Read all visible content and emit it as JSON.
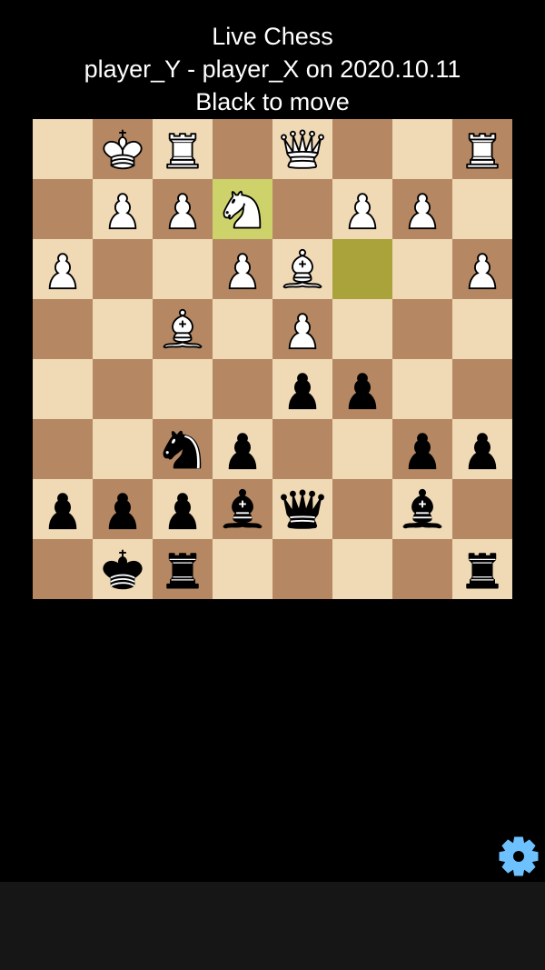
{
  "header": {
    "title": "Live Chess",
    "game": "player_Y - player_X on 2020.10.11",
    "status": "Black to move"
  },
  "board": {
    "orientation": "black",
    "colors": {
      "light": "#F0D9B5",
      "dark": "#B58863",
      "last_move_to": "#CDD26A",
      "last_move_from": "#AAA23A"
    },
    "last_move": {
      "to": [
        1,
        3
      ],
      "from": [
        2,
        5
      ]
    },
    "rows": [
      [
        "",
        "K",
        "R",
        "",
        "Q",
        "",
        "",
        "R"
      ],
      [
        "",
        "P",
        "P",
        "N",
        "",
        "P",
        "P",
        ""
      ],
      [
        "P",
        "",
        "",
        "P",
        "B",
        "",
        "",
        "P"
      ],
      [
        "",
        "",
        "B",
        "",
        "P",
        "",
        "",
        ""
      ],
      [
        "",
        "",
        "",
        "",
        "p",
        "p",
        "",
        ""
      ],
      [
        "",
        "",
        "n",
        "p",
        "",
        "",
        "p",
        "p"
      ],
      [
        "p",
        "p",
        "p",
        "b",
        "q",
        "",
        "b",
        ""
      ],
      [
        "",
        "k",
        "r",
        "",
        "",
        "",
        "",
        "r"
      ]
    ]
  },
  "settings": {
    "icon": "gear-icon",
    "color": "#6EC1FF"
  }
}
